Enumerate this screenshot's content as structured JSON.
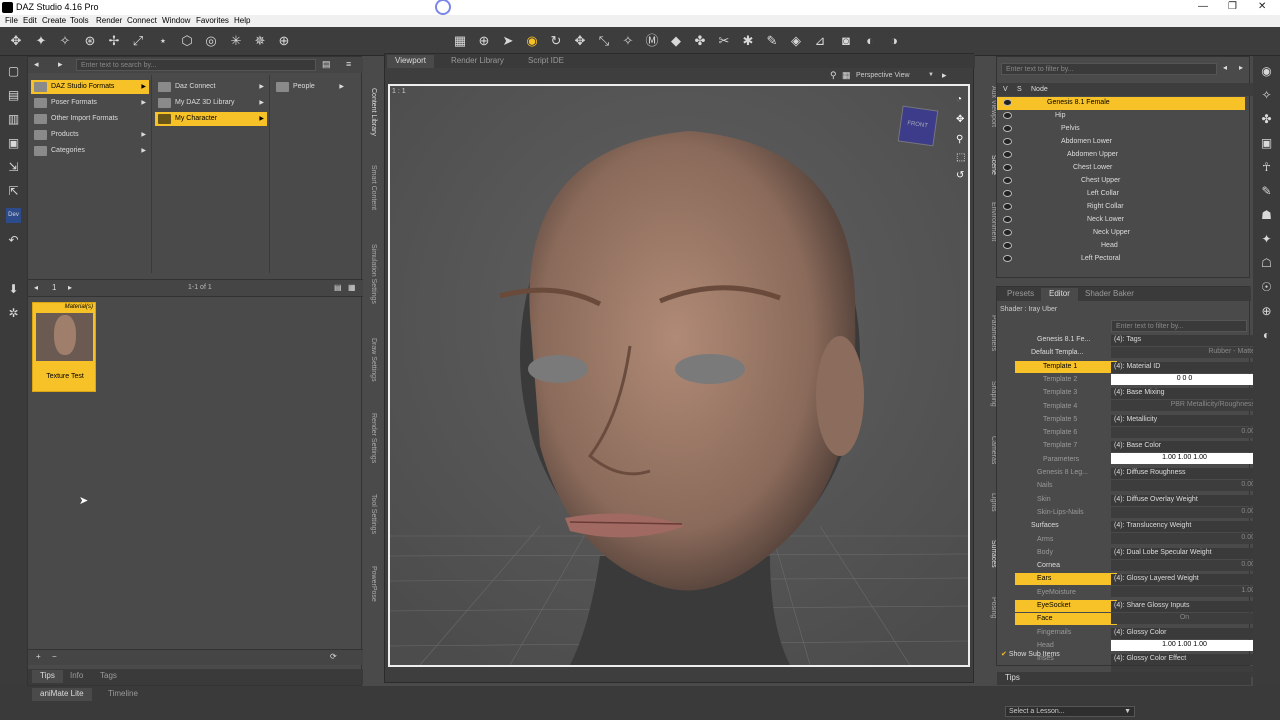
{
  "window": {
    "title": "DAZ Studio 4.16 Pro"
  },
  "menu": [
    "File",
    "Edit",
    "Create",
    "Tools",
    "Render",
    "Connect",
    "Window",
    "Favorites",
    "Help"
  ],
  "content_library": {
    "search_placeholder": "Enter text to search by...",
    "col1": [
      "DAZ Studio Formats",
      "Poser Formats",
      "Other Import Formats",
      "Products",
      "Categories"
    ],
    "col2": [
      "Daz Connect",
      "My DAZ 3D Library",
      "My Character"
    ],
    "col3": [
      "People"
    ],
    "page": "1",
    "count": "1-1 of 1",
    "thumb_badge": "Material(s)",
    "thumb_label": "Texture Test",
    "tabs": [
      "Tips",
      "Info",
      "Tags"
    ],
    "vertical_tabs": [
      "Content Library",
      "Smart Content",
      "Simulation Settings",
      "Draw Settings",
      "Render Settings",
      "Tool Settings",
      "PowerPose"
    ]
  },
  "viewport": {
    "tabs": [
      "Viewport",
      "Render Library",
      "Script IDE"
    ],
    "view_name": "Perspective View",
    "ratio": "1 : 1",
    "cube_label": "FRONT"
  },
  "scene": {
    "filter_placeholder": "Enter text to filter by...",
    "header": [
      "V",
      "S",
      "Node"
    ],
    "nodes": [
      "Genesis 8.1 Female",
      "Hip",
      "Pelvis",
      "Abdomen Lower",
      "Abdomen Upper",
      "Chest Lower",
      "Chest Upper",
      "Left Collar",
      "Right Collar",
      "Neck Lower",
      "Neck Upper",
      "Head",
      "Left Pectoral"
    ],
    "side_tabs": [
      "Aux Viewport",
      "Scene",
      "Environment"
    ]
  },
  "surfaces": {
    "tabs": [
      "Presets",
      "Editor",
      "Shader Baker"
    ],
    "shader": "Shader : Iray Uber",
    "filter_placeholder": "Enter text to filter by...",
    "tree": [
      "Genesis 8.1 Fe...",
      "Default Templa...",
      "Template 1",
      "Template 2",
      "Template 3",
      "Template 4",
      "Template 5",
      "Template 6",
      "Template 7",
      "Parameters",
      "Genesis 8 Leg...",
      "Nails",
      "Skin",
      "Skin-Lips-Nails",
      "Surfaces",
      "Arms",
      "Body",
      "Cornea",
      "Ears",
      "EyeMoisture",
      "EyeSocket",
      "Face",
      "Fingernails",
      "Head",
      "Irises"
    ],
    "show_sub": "Show Sub Items",
    "props": [
      {
        "label": "(4): Tags",
        "value": "Rubber - Matte"
      },
      {
        "label": "(4): Material ID",
        "value": "0          0          0"
      },
      {
        "label": "(4): Base Mixing",
        "value": "PBR Metallicity/Roughness"
      },
      {
        "label": "(4): Metallicity",
        "value": "0.00"
      },
      {
        "label": "(4): Base Color",
        "value": "1.00        1.00        1.00"
      },
      {
        "label": "(4): Diffuse Roughness",
        "value": "0.00"
      },
      {
        "label": "(4): Diffuse Overlay Weight",
        "value": "0.00"
      },
      {
        "label": "(4): Translucency Weight",
        "value": "0.00"
      },
      {
        "label": "(4): Dual Lobe Specular Weight",
        "value": "0.00"
      },
      {
        "label": "(4): Glossy Layered Weight",
        "value": "1.00"
      },
      {
        "label": "(4): Share Glossy Inputs",
        "value": "On"
      },
      {
        "label": "(4): Glossy Color",
        "value": "1.00        1.00        1.00"
      },
      {
        "label": "(4): Glossy Color Effect",
        "value": ""
      }
    ],
    "side_tabs": [
      "Parameters",
      "Shaping",
      "Cameras",
      "Lights",
      "Surfaces",
      "Posing"
    ]
  },
  "bottom": {
    "tabs": [
      "aniMate Lite",
      "Timeline"
    ],
    "lesson": "Select a Lesson...",
    "tips_tab": "Tips"
  }
}
